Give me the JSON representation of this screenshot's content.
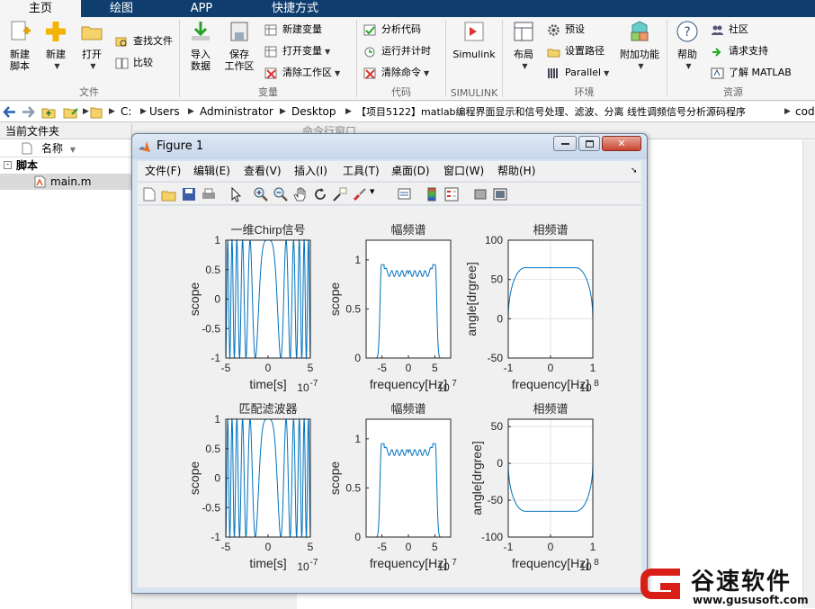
{
  "ribbon": {
    "tabs": [
      "主页",
      "绘图",
      "APP",
      "快捷方式"
    ],
    "sections": {
      "file": {
        "title": "文件",
        "new_script": "新建\n脚本",
        "new": "新建",
        "open": "打开",
        "find_files": "查找文件",
        "compare": "比较"
      },
      "variable": {
        "title": "变量",
        "import": "导入\n数据",
        "save": "保存\n工作区",
        "new_var": "新建变量",
        "open_var": "打开变量",
        "clear_ws": "清除工作区"
      },
      "code": {
        "title": "代码",
        "analyze": "分析代码",
        "run_time": "运行并计时",
        "clear_cmd": "清除命令"
      },
      "simulink": {
        "title": "SIMULINK",
        "simulink": "Simulink"
      },
      "env": {
        "title": "环境",
        "layout": "布局",
        "prefs": "预设",
        "set_path": "设置路径",
        "parallel": "Parallel",
        "addons": "附加功能"
      },
      "resources": {
        "title": "资源",
        "help": "帮助",
        "community": "社区",
        "support": "请求支持",
        "learn": "了解 MATLAB"
      }
    }
  },
  "address": {
    "crumbs": [
      "C:",
      "Users",
      "Administrator",
      "Desktop",
      "【项目5122】matlab编程界面显示和信号处理、滤波、分离 线性调频信号分析源码程序",
      "cod"
    ]
  },
  "left_panel": {
    "title": "当前文件夹",
    "column": "名称",
    "folder": "脚本",
    "file": "main.m"
  },
  "right_panel": {
    "title": "命令行窗口"
  },
  "figure": {
    "title": "Figure 1",
    "menus": [
      "文件(F)",
      "编辑(E)",
      "查看(V)",
      "插入(I)",
      "工具(T)",
      "桌面(D)",
      "窗口(W)",
      "帮助(H)"
    ],
    "toolbar_icons": [
      "new-figure-icon",
      "open-icon",
      "save-icon",
      "print-icon",
      "pointer-icon",
      "zoom-in-icon",
      "zoom-out-icon",
      "pan-icon",
      "rotate-icon",
      "data-cursor-icon",
      "brush-icon",
      "link-icon",
      "colorbar-icon",
      "legend-icon",
      "hide-plot-tools-icon",
      "show-plot-tools-icon"
    ]
  },
  "chart_data": [
    {
      "type": "line",
      "title": "一维Chirp信号",
      "xlabel": "time[s]",
      "ylabel": "scope",
      "x_exponent": "10^-7",
      "xlim": [
        -5,
        5
      ],
      "ylim": [
        -1,
        1
      ],
      "xticks": [
        "-5",
        "0",
        "5"
      ],
      "yticks": [
        "-1",
        "-0.5",
        "0",
        "0.5",
        "1"
      ],
      "series": [
        {
          "function": "cos(pi*k*t^2)",
          "k_note": "linear chirp, unit amplitude"
        }
      ]
    },
    {
      "type": "line",
      "title": "幅频谱",
      "xlabel": "frequency[Hz]",
      "ylabel": "scope",
      "x_exponent": "10^7",
      "xlim": [
        -8,
        8
      ],
      "ylim": [
        0,
        1.2
      ],
      "xticks": [
        "-5",
        "0",
        "5"
      ],
      "yticks": [
        "0",
        "0.5",
        "1"
      ],
      "series": [
        {
          "x": [
            -8,
            -6,
            -5.2,
            -5,
            -4.8,
            -4,
            -2,
            0,
            2,
            4,
            4.8,
            5,
            5.2,
            6,
            8
          ],
          "y": [
            0.0,
            0.05,
            0.4,
            0.92,
            0.95,
            0.85,
            0.88,
            0.84,
            0.88,
            0.85,
            0.95,
            0.92,
            0.4,
            0.05,
            0.0
          ]
        }
      ]
    },
    {
      "type": "line",
      "title": "相频谱",
      "xlabel": "frequency[Hz]",
      "ylabel": "angle[drgree]",
      "x_exponent": "10^8",
      "xlim": [
        -1,
        1
      ],
      "ylim": [
        -50,
        100
      ],
      "xticks": [
        "-1",
        "0",
        "1"
      ],
      "yticks": [
        "-50",
        "0",
        "50",
        "100"
      ],
      "series": [
        {
          "x": [
            -1,
            -0.9,
            -0.8,
            -0.7,
            -0.6,
            0,
            0.6,
            0.7,
            0.8,
            0.9,
            1
          ],
          "y": [
            0,
            30,
            50,
            60,
            64,
            65,
            64,
            60,
            50,
            30,
            0
          ]
        }
      ]
    },
    {
      "type": "line",
      "title": "匹配滤波器",
      "xlabel": "time[s]",
      "ylabel": "scope",
      "x_exponent": "10^-7",
      "xlim": [
        -5,
        5
      ],
      "ylim": [
        -1,
        1
      ],
      "xticks": [
        "-5",
        "0",
        "5"
      ],
      "yticks": [
        "-1",
        "-0.5",
        "0",
        "0.5",
        "1"
      ],
      "series": [
        {
          "function": "cos(pi*k*t^2)",
          "k_note": "linear chirp, unit amplitude"
        }
      ]
    },
    {
      "type": "line",
      "title": "幅频谱",
      "xlabel": "frequency[Hz]",
      "ylabel": "scope",
      "x_exponent": "10^7",
      "xlim": [
        -8,
        8
      ],
      "ylim": [
        0,
        1.2
      ],
      "xticks": [
        "-5",
        "0",
        "5"
      ],
      "yticks": [
        "0",
        "0.5",
        "1"
      ],
      "series": [
        {
          "x": [
            -8,
            -6,
            -5.2,
            -5,
            -4.8,
            -4,
            -2,
            0,
            2,
            4,
            4.8,
            5,
            5.2,
            6,
            8
          ],
          "y": [
            0.0,
            0.05,
            0.4,
            0.92,
            0.95,
            0.85,
            0.88,
            0.84,
            0.88,
            0.85,
            0.95,
            0.92,
            0.4,
            0.05,
            0.0
          ]
        }
      ]
    },
    {
      "type": "line",
      "title": "相频谱",
      "xlabel": "frequency[Hz]",
      "ylabel": "angle[drgree]",
      "x_exponent": "10^8",
      "xlim": [
        -1,
        1
      ],
      "ylim": [
        -100,
        60
      ],
      "xticks": [
        "-1",
        "0",
        "1"
      ],
      "yticks": [
        "-100",
        "-50",
        "0",
        "50"
      ],
      "series": [
        {
          "x": [
            -1,
            -0.9,
            -0.8,
            -0.7,
            -0.6,
            0,
            0.6,
            0.7,
            0.8,
            0.9,
            1
          ],
          "y": [
            0,
            -30,
            -50,
            -60,
            -64,
            -65,
            -64,
            -60,
            -50,
            -30,
            0
          ]
        }
      ]
    }
  ],
  "watermark": {
    "name": "谷速软件",
    "url": "www.gususoft.com"
  },
  "colors": {
    "ribbon_tab_bg": "#0f3e6e",
    "line": "#0072bd",
    "watermark_red": "#d91e18"
  }
}
